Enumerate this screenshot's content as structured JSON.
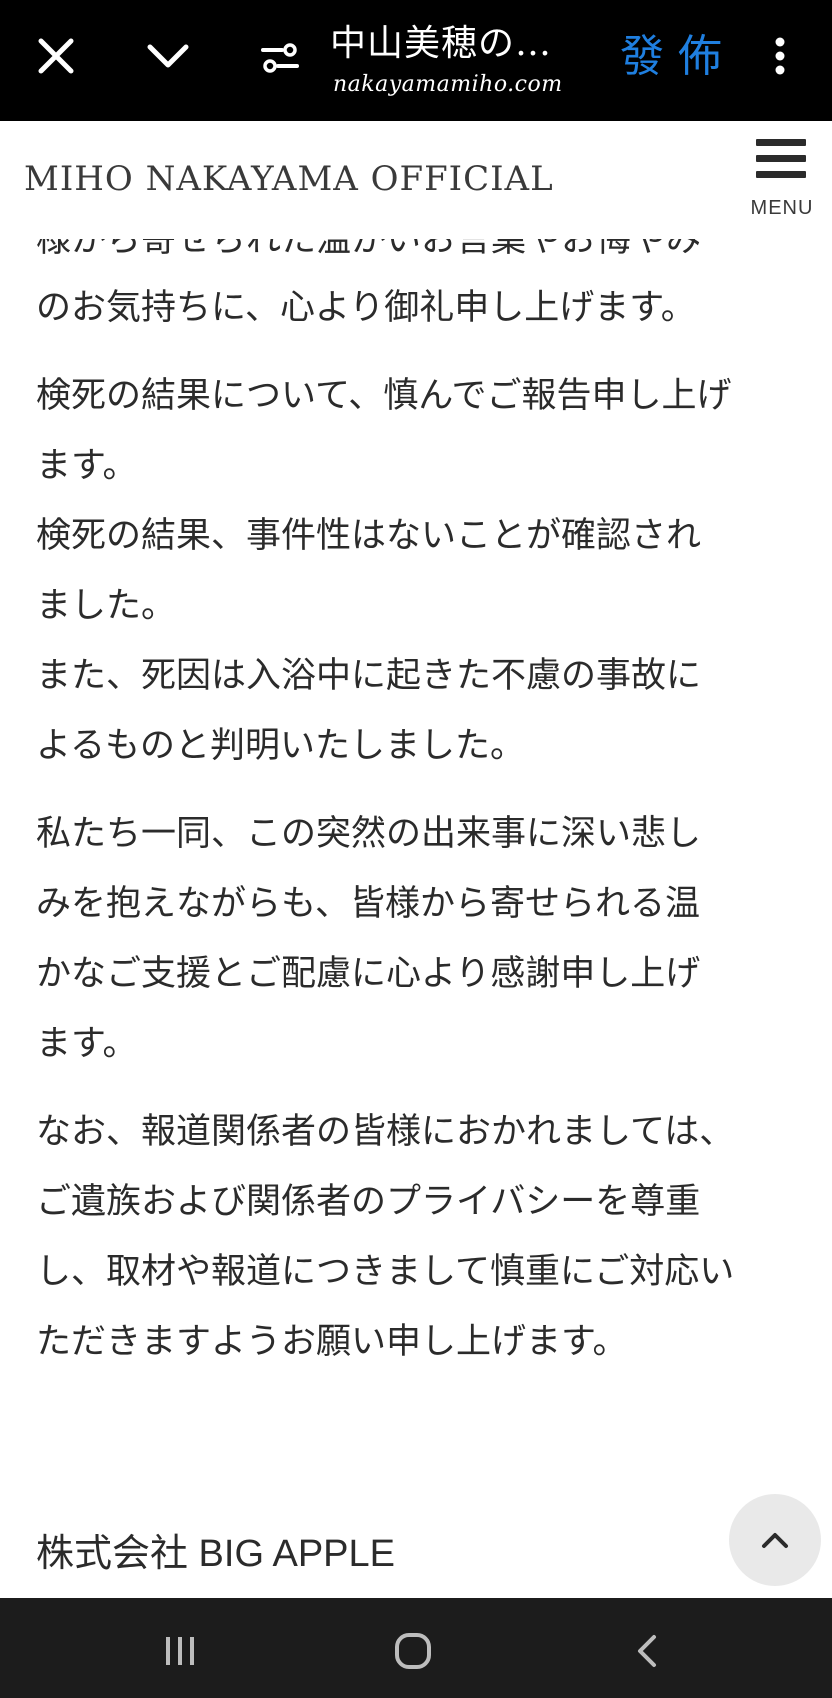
{
  "browser": {
    "title": "中山美穂の…",
    "url": "nakayamamiho.com",
    "stamp": "發佈"
  },
  "site": {
    "title": "MIHO NAKAYAMA OFFICIAL",
    "menu_label": "MENU"
  },
  "article": {
    "clipped_line": "様から寄せられた温かいお言葉やお悔やみ",
    "paragraphs": [
      [
        "のお気持ちに、心より御礼申し上げます。"
      ],
      [
        "検死の結果について、慎んでご報告申し上げ",
        "ます。",
        "検死の結果、事件性はないことが確認され",
        "ました。",
        "また、死因は入浴中に起きた不慮の事故に",
        "よるものと判明いたしました。"
      ],
      [
        "私たち一同、この突然の出来事に深い悲し",
        "みを抱えながらも、皆様から寄せられる温",
        "かなご支援とご配慮に心より感謝申し上げ",
        "ます。"
      ],
      [
        "なお、報道関係者の皆様におかれましては、",
        "ご遺族および関係者のプライバシーを尊重",
        "し、取材や報道につきまして慎重にご対応い",
        "ただきますようお願い申し上げます。"
      ]
    ],
    "company": "株式会社 BIG APPLE"
  },
  "icons": {
    "close": "close-icon",
    "chevron": "chevron-down-icon",
    "tune": "tune-icon",
    "kebab": "more-vert-icon",
    "menu": "hamburger-icon",
    "scroll_top": "chevron-up-icon",
    "recent": "recent-apps-icon",
    "home": "home-icon",
    "back": "back-icon"
  },
  "colors": {
    "topbar": "#000000",
    "stamp": "#1f7fe0",
    "navbar": "#1c1c1c",
    "text": "#2b2b2b"
  }
}
